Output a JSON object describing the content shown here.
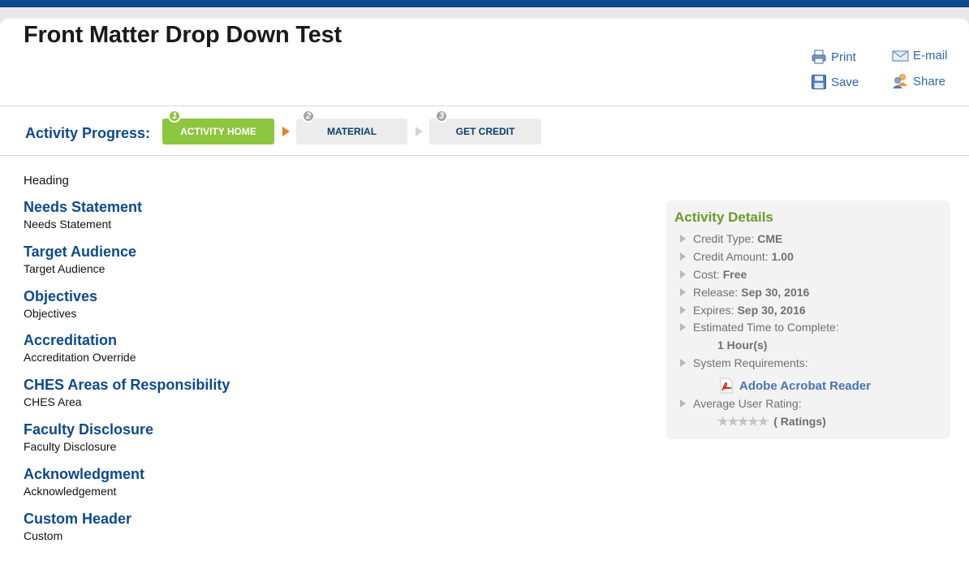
{
  "page": {
    "title": "Front Matter Drop Down Test"
  },
  "toolbar": {
    "print": "Print",
    "email": "E-mail",
    "save": "Save",
    "share": "Share"
  },
  "progress": {
    "label": "Activity Progress:",
    "steps": [
      {
        "number": "1",
        "label": "ACTIVITY HOME",
        "state": "active"
      },
      {
        "number": "2",
        "label": "MATERIAL",
        "state": "inactive"
      },
      {
        "number": "3",
        "label": "GET CREDIT",
        "state": "inactive"
      }
    ],
    "colors": {
      "active": "#8dc63f",
      "arrow_active": "#f07f1a",
      "inactive": "#ececec"
    }
  },
  "content": {
    "heading": "Heading",
    "sections": [
      {
        "title": "Needs Statement",
        "body": "Needs Statement"
      },
      {
        "title": "Target Audience",
        "body": "Target Audience"
      },
      {
        "title": "Objectives",
        "body": "Objectives"
      },
      {
        "title": "Accreditation",
        "body": "Accreditation Override"
      },
      {
        "title": "CHES Areas of Responsibility",
        "body": "CHES Area"
      },
      {
        "title": "Faculty Disclosure",
        "body": "Faculty Disclosure"
      },
      {
        "title": "Acknowledgment",
        "body": "Acknowledgement"
      },
      {
        "title": "Custom Header",
        "body": "Custom"
      }
    ]
  },
  "details": {
    "title": "Activity Details",
    "credit_type_label": "Credit Type:",
    "credit_type_value": "CME",
    "credit_amount_label": "Credit Amount:",
    "credit_amount_value": "1.00",
    "cost_label": "Cost:",
    "cost_value": "Free",
    "release_label": "Release:",
    "release_value": "Sep 30, 2016",
    "expires_label": "Expires:",
    "expires_value": "Sep 30, 2016",
    "time_label": "Estimated Time to Complete:",
    "time_value": "1 Hour(s)",
    "sysreq_label": "System Requirements:",
    "sysreq_link": "Adobe Acrobat Reader",
    "rating_label": "Average User Rating:",
    "rating_text": "( Ratings)",
    "rating_stars": "★★★★★"
  },
  "colors": {
    "brand_blue": "#0d4a8b",
    "link_blue": "#2f66a8",
    "details_green": "#6b9a2d"
  },
  "icons": [
    "printer-icon",
    "email-icon",
    "save-icon",
    "share-icon",
    "pdf-icon",
    "star-rating-icon"
  ]
}
